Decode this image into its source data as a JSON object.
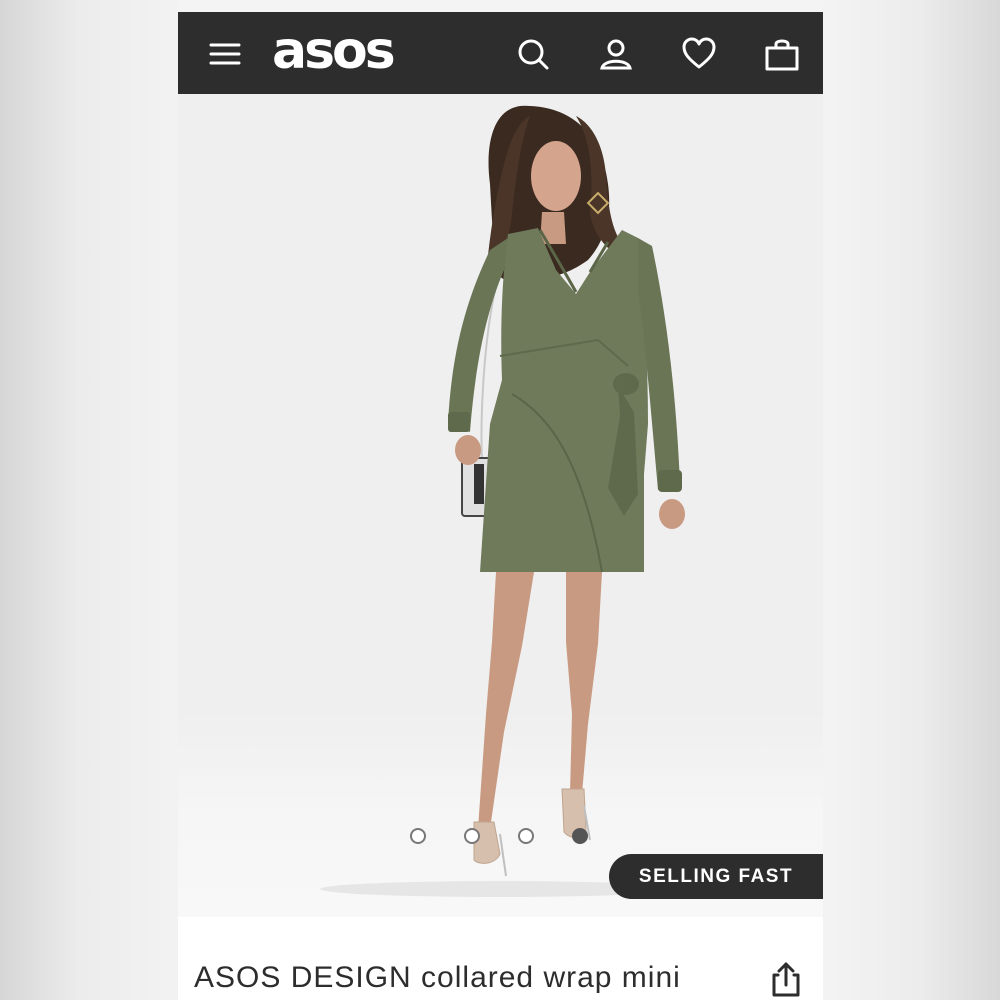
{
  "header": {
    "brand": "asos",
    "icons": [
      "hamburger-menu-icon",
      "search-icon",
      "account-icon",
      "heart-icon",
      "bag-icon"
    ]
  },
  "product": {
    "badge": "SELLING FAST",
    "title": "ASOS DESIGN collared wrap mini",
    "image_count": 4,
    "active_image": 4,
    "dress_color": "#6f7a5b"
  },
  "colors": {
    "header_bg": "#2d2d2d",
    "header_fg": "#ffffff",
    "badge_bg": "#2d2d2d"
  }
}
